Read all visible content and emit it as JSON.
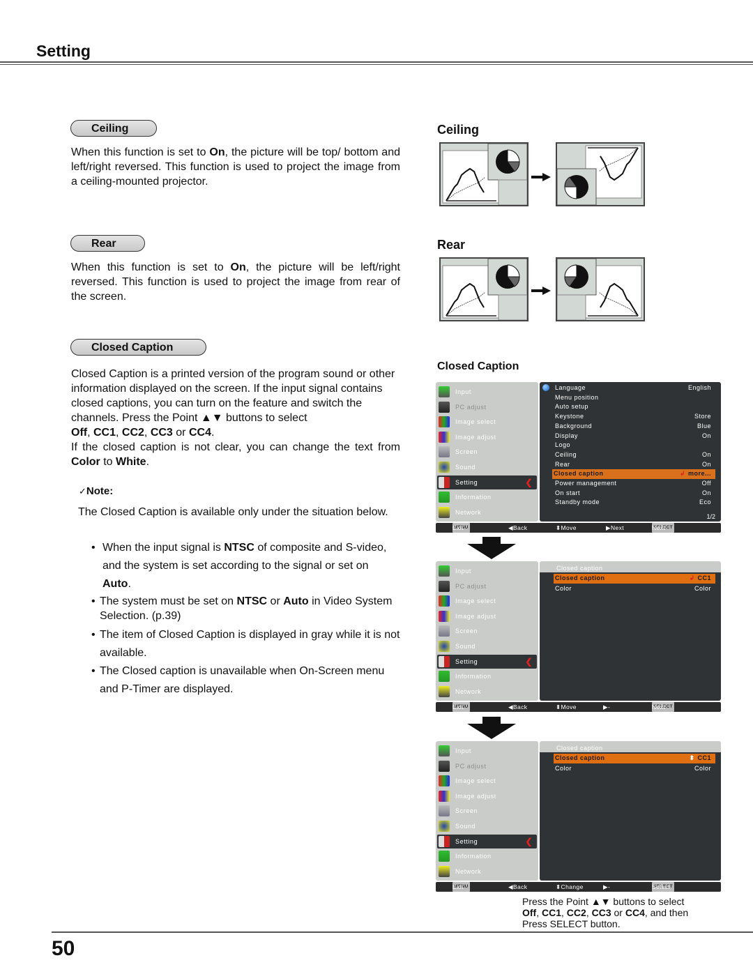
{
  "page": {
    "title": "Setting",
    "number": "50"
  },
  "sections": {
    "ceiling": {
      "pill_label": "Ceiling",
      "text_parts": [
        "When this function is set to ",
        "On",
        ", the picture will be top/ bottom and left/right reversed. This function is used to project the image from a ceiling-mounted projector."
      ],
      "diagram_heading": "Ceiling"
    },
    "rear": {
      "pill_label": "Rear",
      "text_parts": [
        "When this function is set to ",
        "On",
        ", the picture will be left/right reversed. This function is used to project the image from rear of the screen."
      ],
      "diagram_heading": "Rear"
    },
    "closed_caption": {
      "pill_label": "Closed Caption",
      "diagram_heading": "Closed Caption",
      "p1": "Closed Caption is a printed version of the program sound or other information displayed on the screen. If the input signal contains closed captions, you can turn on the feature and switch the channels. Press the Point ▲▼ buttons to select",
      "options_line": [
        "Off",
        ", ",
        "CC1",
        ", ",
        "CC2",
        ", ",
        "CC3",
        " or ",
        "CC4",
        "."
      ],
      "p2_parts": [
        "If the closed caption is not clear, you can change the text from ",
        "Color",
        " to ",
        "White",
        "."
      ]
    }
  },
  "note": {
    "label": "Note:",
    "check_icon": "✓",
    "intro": "The Closed Caption is available only under the situation below.",
    "bullets": [
      {
        "parts": [
          "When the input signal is ",
          "NTSC",
          " of composite and S-video, and the system is set according to the signal or set on ",
          "Auto",
          "."
        ]
      },
      {
        "parts": [
          "The system must be set on ",
          "NTSC",
          " or ",
          "Auto",
          " in Video System Selection. (p.39)"
        ]
      },
      {
        "parts": [
          "The item of Closed Caption is displayed in gray while it is not available."
        ]
      },
      {
        "parts": [
          "The Closed caption is unavailable when On-Screen menu and P-Timer are displayed."
        ]
      }
    ]
  },
  "osd": {
    "left_menu": [
      {
        "label": "Input",
        "icon": "input-icon",
        "dim": false
      },
      {
        "label": "PC adjust",
        "icon": "pc-adjust-icon",
        "dim": true
      },
      {
        "label": "Image select",
        "icon": "image-select-icon",
        "dim": false
      },
      {
        "label": "Image adjust",
        "icon": "image-adjust-icon",
        "dim": false
      },
      {
        "label": "Screen",
        "icon": "screen-icon",
        "dim": false
      },
      {
        "label": "Sound",
        "icon": "sound-icon",
        "dim": false
      },
      {
        "label": "Setting",
        "icon": "setting-icon",
        "dim": false,
        "selected": true
      },
      {
        "label": "Information",
        "icon": "information-icon",
        "dim": false
      },
      {
        "label": "Network",
        "icon": "network-icon",
        "dim": false
      }
    ],
    "screen1": {
      "rows": [
        {
          "label": "Language",
          "value": "English"
        },
        {
          "label": "Menu position",
          "value": ""
        },
        {
          "label": "Auto setup",
          "value": ""
        },
        {
          "label": "Keystone",
          "value": "Store"
        },
        {
          "label": "Background",
          "value": "Blue"
        },
        {
          "label": "Display",
          "value": "On"
        },
        {
          "label": "Logo",
          "value": ""
        },
        {
          "label": "Ceiling",
          "value": "On"
        },
        {
          "label": "Rear",
          "value": "On"
        },
        {
          "label": "Closed caption",
          "value": "more...",
          "highlighted": true
        },
        {
          "label": "Power management",
          "value": "Off"
        },
        {
          "label": "On start",
          "value": "On"
        },
        {
          "label": "Standby mode",
          "value": "Eco"
        }
      ],
      "page_indicator": "1/2",
      "bar": {
        "exit_key": "MENU",
        "exit": "Exit",
        "back": "Back",
        "move": "Move",
        "next": "Next",
        "select_key": "SELECT",
        "select": "Next"
      }
    },
    "screen2": {
      "subheading": "Closed caption",
      "rows": [
        {
          "label": "Closed caption",
          "value": "CC1",
          "highlighted": true
        },
        {
          "label": "Color",
          "value": "Color"
        }
      ],
      "bar": {
        "exit_key": "MENU",
        "exit": "Exit",
        "back": "Back",
        "move": "Move",
        "next": "-----",
        "select_key": "SELECT",
        "select": "Next"
      }
    },
    "screen3": {
      "subheading": "Closed caption",
      "rows": [
        {
          "label": "Closed caption",
          "value": "CC1",
          "highlighted": true
        },
        {
          "label": "Color",
          "value": "Color"
        }
      ],
      "bar": {
        "exit_key": "MENU",
        "exit": "Exit",
        "back": "Back",
        "move": "Change",
        "next": "-----",
        "select_key": "SELECT",
        "select": "Select"
      }
    }
  },
  "bottom_caption": {
    "line1": "Press the Point ▲▼ buttons to select",
    "line2": [
      "Off",
      ", ",
      "CC1",
      ", ",
      "CC2",
      ", ",
      "CC3",
      " or ",
      "CC4",
      ", and then"
    ],
    "line3": "Press SELECT button."
  },
  "colors": {
    "highlight_orange": "#d9701c",
    "osd_dark": "#2f3335",
    "osd_light": "#c9ccc9",
    "chevron_red": "#e02020"
  }
}
